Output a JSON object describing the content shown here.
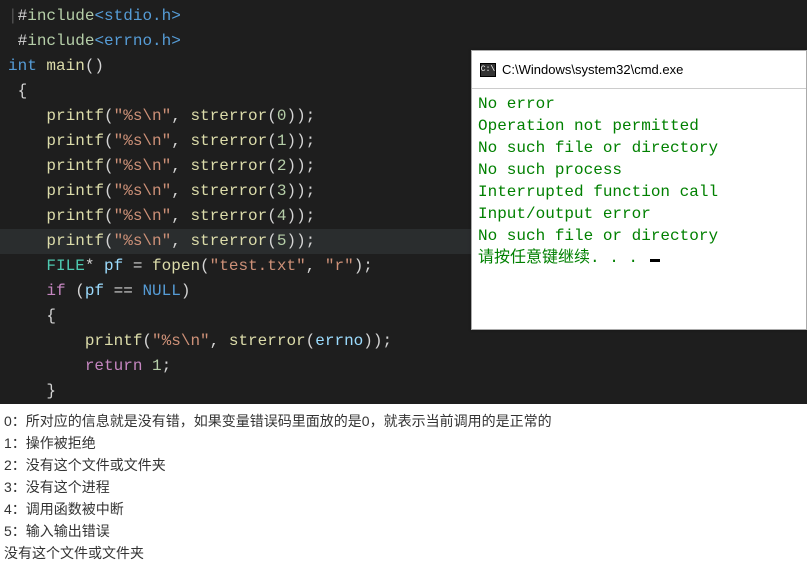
{
  "code": {
    "lines": [
      [
        {
          "cls": "tk-cursor",
          "t": "|"
        },
        {
          "cls": "tk-punct",
          "t": "#"
        },
        {
          "cls": "tk-include",
          "t": "include"
        },
        {
          "cls": "tk-header",
          "t": "<stdio.h>"
        }
      ],
      [
        {
          "cls": "tk-plain",
          "t": " "
        },
        {
          "cls": "tk-punct",
          "t": "#"
        },
        {
          "cls": "tk-include",
          "t": "include"
        },
        {
          "cls": "tk-header",
          "t": "<errno.h>"
        }
      ],
      [
        {
          "cls": "tk-keyword",
          "t": "int"
        },
        {
          "cls": "tk-plain",
          "t": " "
        },
        {
          "cls": "tk-func",
          "t": "main"
        },
        {
          "cls": "tk-punct",
          "t": "()"
        }
      ],
      [
        {
          "cls": "tk-plain",
          "t": " "
        },
        {
          "cls": "tk-punct",
          "t": "{"
        }
      ],
      [
        {
          "cls": "tk-plain",
          "t": "    "
        },
        {
          "cls": "tk-func",
          "t": "printf"
        },
        {
          "cls": "tk-punct",
          "t": "("
        },
        {
          "cls": "tk-string",
          "t": "\"%s\\n\""
        },
        {
          "cls": "tk-punct",
          "t": ", "
        },
        {
          "cls": "tk-func",
          "t": "strerror"
        },
        {
          "cls": "tk-punct",
          "t": "("
        },
        {
          "cls": "tk-number",
          "t": "0"
        },
        {
          "cls": "tk-punct",
          "t": "));"
        }
      ],
      [
        {
          "cls": "tk-plain",
          "t": "    "
        },
        {
          "cls": "tk-func",
          "t": "printf"
        },
        {
          "cls": "tk-punct",
          "t": "("
        },
        {
          "cls": "tk-string",
          "t": "\"%s\\n\""
        },
        {
          "cls": "tk-punct",
          "t": ", "
        },
        {
          "cls": "tk-func",
          "t": "strerror"
        },
        {
          "cls": "tk-punct",
          "t": "("
        },
        {
          "cls": "tk-number",
          "t": "1"
        },
        {
          "cls": "tk-punct",
          "t": "));"
        }
      ],
      [
        {
          "cls": "tk-plain",
          "t": "    "
        },
        {
          "cls": "tk-func",
          "t": "printf"
        },
        {
          "cls": "tk-punct",
          "t": "("
        },
        {
          "cls": "tk-string",
          "t": "\"%s\\n\""
        },
        {
          "cls": "tk-punct",
          "t": ", "
        },
        {
          "cls": "tk-func",
          "t": "strerror"
        },
        {
          "cls": "tk-punct",
          "t": "("
        },
        {
          "cls": "tk-number",
          "t": "2"
        },
        {
          "cls": "tk-punct",
          "t": "));"
        }
      ],
      [
        {
          "cls": "tk-plain",
          "t": "    "
        },
        {
          "cls": "tk-func",
          "t": "printf"
        },
        {
          "cls": "tk-punct",
          "t": "("
        },
        {
          "cls": "tk-string",
          "t": "\"%s\\n\""
        },
        {
          "cls": "tk-punct",
          "t": ", "
        },
        {
          "cls": "tk-func",
          "t": "strerror"
        },
        {
          "cls": "tk-punct",
          "t": "("
        },
        {
          "cls": "tk-number",
          "t": "3"
        },
        {
          "cls": "tk-punct",
          "t": "));"
        }
      ],
      [
        {
          "cls": "tk-plain",
          "t": "    "
        },
        {
          "cls": "tk-func",
          "t": "printf"
        },
        {
          "cls": "tk-punct",
          "t": "("
        },
        {
          "cls": "tk-string",
          "t": "\"%s\\n\""
        },
        {
          "cls": "tk-punct",
          "t": ", "
        },
        {
          "cls": "tk-func",
          "t": "strerror"
        },
        {
          "cls": "tk-punct",
          "t": "("
        },
        {
          "cls": "tk-number",
          "t": "4"
        },
        {
          "cls": "tk-punct",
          "t": "));"
        }
      ],
      [
        {
          "cls": "tk-plain",
          "t": "    "
        },
        {
          "cls": "tk-func",
          "t": "printf"
        },
        {
          "cls": "tk-punct",
          "t": "("
        },
        {
          "cls": "tk-string",
          "t": "\"%s\\n\""
        },
        {
          "cls": "tk-punct",
          "t": ", "
        },
        {
          "cls": "tk-func",
          "t": "strerror"
        },
        {
          "cls": "tk-punct",
          "t": "("
        },
        {
          "cls": "tk-number",
          "t": "5"
        },
        {
          "cls": "tk-punct",
          "t": "));"
        }
      ],
      [
        {
          "cls": "tk-plain",
          "t": "    "
        },
        {
          "cls": "tk-type",
          "t": "FILE"
        },
        {
          "cls": "tk-punct",
          "t": "* "
        },
        {
          "cls": "tk-ident",
          "t": "pf"
        },
        {
          "cls": "tk-punct",
          "t": " = "
        },
        {
          "cls": "tk-func",
          "t": "fopen"
        },
        {
          "cls": "tk-punct",
          "t": "("
        },
        {
          "cls": "tk-string",
          "t": "\"test.txt\""
        },
        {
          "cls": "tk-punct",
          "t": ", "
        },
        {
          "cls": "tk-string",
          "t": "\"r\""
        },
        {
          "cls": "tk-punct",
          "t": ");"
        }
      ],
      [
        {
          "cls": "tk-plain",
          "t": "    "
        },
        {
          "cls": "tk-macro",
          "t": "if"
        },
        {
          "cls": "tk-plain",
          "t": " "
        },
        {
          "cls": "tk-punct",
          "t": "("
        },
        {
          "cls": "tk-ident",
          "t": "pf"
        },
        {
          "cls": "tk-punct",
          "t": " == "
        },
        {
          "cls": "tk-keyword",
          "t": "NULL"
        },
        {
          "cls": "tk-punct",
          "t": ")"
        }
      ],
      [
        {
          "cls": "tk-plain",
          "t": "    "
        },
        {
          "cls": "tk-punct",
          "t": "{"
        }
      ],
      [
        {
          "cls": "tk-plain",
          "t": "        "
        },
        {
          "cls": "tk-func",
          "t": "printf"
        },
        {
          "cls": "tk-punct",
          "t": "("
        },
        {
          "cls": "tk-string",
          "t": "\"%s\\n\""
        },
        {
          "cls": "tk-punct",
          "t": ", "
        },
        {
          "cls": "tk-func",
          "t": "strerror"
        },
        {
          "cls": "tk-punct",
          "t": "("
        },
        {
          "cls": "tk-ident",
          "t": "errno"
        },
        {
          "cls": "tk-punct",
          "t": "));"
        }
      ],
      [
        {
          "cls": "tk-plain",
          "t": "        "
        },
        {
          "cls": "tk-macro",
          "t": "return"
        },
        {
          "cls": "tk-plain",
          "t": " "
        },
        {
          "cls": "tk-number",
          "t": "1"
        },
        {
          "cls": "tk-punct",
          "t": ";"
        }
      ],
      [
        {
          "cls": "tk-plain",
          "t": "    "
        },
        {
          "cls": "tk-punct",
          "t": "}"
        }
      ]
    ],
    "highlight_index": 9
  },
  "console": {
    "title": "C:\\Windows\\system32\\cmd.exe",
    "icon_text": "C:\\",
    "lines": [
      "No error",
      "Operation not permitted",
      "No such file or directory",
      "No such process",
      "Interrupted function call",
      "Input/output error",
      "No such file or directory",
      "请按任意键继续. . . "
    ]
  },
  "notes": [
    "0：所对应的信息就是没有错，如果变量错误码里面放的是0，就表示当前调用的是正常的",
    "1：操作被拒绝",
    "2：没有这个文件或文件夹",
    "3：没有这个进程",
    "4：调用函数被中断",
    "5：输入输出错误",
    "没有这个文件或文件夹"
  ]
}
